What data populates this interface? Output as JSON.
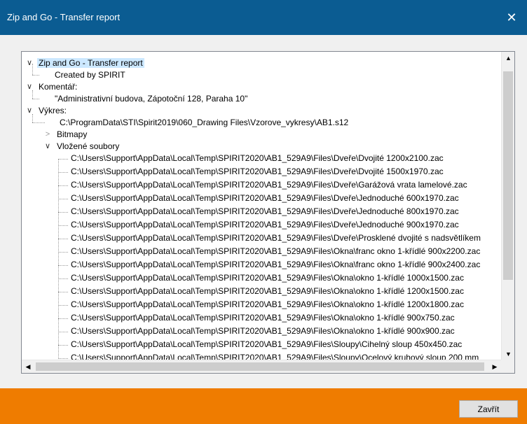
{
  "window": {
    "title": "Zip and Go - Transfer report",
    "close_glyph": "✕"
  },
  "tree": {
    "root": "Zip and Go - Transfer report",
    "created_by": "Created by SPIRIT",
    "comment_label": "Komentář:",
    "comment_value": "\"Administrativní budova, Zápotoční 128, Paraha 10\"",
    "drawing_label": "Výkres:",
    "drawing_path": "C:\\ProgramData\\STI\\Spirit2019\\060_Drawing Files\\Vzorove_vykresy\\AB1.s12",
    "bitmaps_label": "Bitmapy",
    "embedded_label": "Vložené soubory",
    "files": [
      "C:\\Users\\Support\\AppData\\Local\\Temp\\SPIRIT2020\\AB1_529A9\\Files\\Dveře\\Dvojité 1200x2100.zac",
      "C:\\Users\\Support\\AppData\\Local\\Temp\\SPIRIT2020\\AB1_529A9\\Files\\Dveře\\Dvojité 1500x1970.zac",
      "C:\\Users\\Support\\AppData\\Local\\Temp\\SPIRIT2020\\AB1_529A9\\Files\\Dveře\\Garážová vrata lamelové.zac",
      "C:\\Users\\Support\\AppData\\Local\\Temp\\SPIRIT2020\\AB1_529A9\\Files\\Dveře\\Jednoduché 600x1970.zac",
      "C:\\Users\\Support\\AppData\\Local\\Temp\\SPIRIT2020\\AB1_529A9\\Files\\Dveře\\Jednoduché 800x1970.zac",
      "C:\\Users\\Support\\AppData\\Local\\Temp\\SPIRIT2020\\AB1_529A9\\Files\\Dveře\\Jednoduché 900x1970.zac",
      "C:\\Users\\Support\\AppData\\Local\\Temp\\SPIRIT2020\\AB1_529A9\\Files\\Dveře\\Prosklené dvojité s nadsvětlíkem",
      "C:\\Users\\Support\\AppData\\Local\\Temp\\SPIRIT2020\\AB1_529A9\\Files\\Okna\\franc okno 1-křídlé 900x2200.zac",
      "C:\\Users\\Support\\AppData\\Local\\Temp\\SPIRIT2020\\AB1_529A9\\Files\\Okna\\franc okno 1-křídlé 900x2400.zac",
      "C:\\Users\\Support\\AppData\\Local\\Temp\\SPIRIT2020\\AB1_529A9\\Files\\Okna\\okno 1-křídlé 1000x1500.zac",
      "C:\\Users\\Support\\AppData\\Local\\Temp\\SPIRIT2020\\AB1_529A9\\Files\\Okna\\okno 1-křídlé 1200x1500.zac",
      "C:\\Users\\Support\\AppData\\Local\\Temp\\SPIRIT2020\\AB1_529A9\\Files\\Okna\\okno 1-křídlé 1200x1800.zac",
      "C:\\Users\\Support\\AppData\\Local\\Temp\\SPIRIT2020\\AB1_529A9\\Files\\Okna\\okno 1-křídlé 900x750.zac",
      "C:\\Users\\Support\\AppData\\Local\\Temp\\SPIRIT2020\\AB1_529A9\\Files\\Okna\\okno 1-křídlé 900x900.zac",
      "C:\\Users\\Support\\AppData\\Local\\Temp\\SPIRIT2020\\AB1_529A9\\Files\\Sloupy\\Cihelný sloup 450x450.zac",
      "C:\\Users\\Support\\AppData\\Local\\Temp\\SPIRIT2020\\AB1_529A9\\Files\\Sloupy\\Ocelový kruhový sloup 200 mm"
    ]
  },
  "icons": {
    "expanded": "chevron-down-icon",
    "collapsed": "chevron-right-icon"
  },
  "footer": {
    "close_button": "Zavřít"
  },
  "colors": {
    "titlebar": "#0b5c92",
    "footer": "#ef7c00",
    "selection": "#cce8ff"
  }
}
